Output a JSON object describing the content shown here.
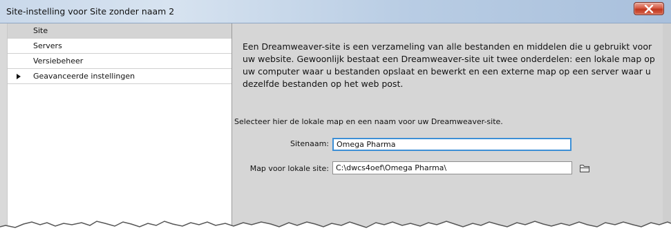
{
  "window": {
    "title": "Site-instelling voor Site zonder naam 2"
  },
  "sidebar": {
    "items": [
      {
        "label": "Site",
        "selected": true,
        "expandable": false
      },
      {
        "label": "Servers",
        "selected": false,
        "expandable": false
      },
      {
        "label": "Versiebeheer",
        "selected": false,
        "expandable": false
      },
      {
        "label": "Geavanceerde instellingen",
        "selected": false,
        "expandable": true
      }
    ]
  },
  "main": {
    "description": "Een Dreamweaver-site is een verzameling van alle bestanden en middelen die u gebruikt voor uw website. Gewoonlijk bestaat een Dreamweaver-site uit twee onderdelen: een lokale map op uw computer waar u bestanden opslaat en bewerkt en een externe map op een server waar u dezelfde bestanden op het web post.",
    "instruction": "Selecteer hier de lokale map en een naam voor uw Dreamweaver-site.",
    "site_name": {
      "label": "Sitenaam:",
      "value": "Omega Pharma"
    },
    "local_folder": {
      "label": "Map voor lokale site:",
      "value": "C:\\dwcs4oef\\Omega Pharma\\"
    }
  },
  "icons": {
    "close": "close-icon",
    "folder": "folder-icon",
    "expand": "triangle-right-icon"
  },
  "colors": {
    "focus_border": "#3c8fd6",
    "close_button": "#c9432c",
    "panel_bg": "#d6d6d6",
    "selected_item": "#d4d4d4"
  }
}
